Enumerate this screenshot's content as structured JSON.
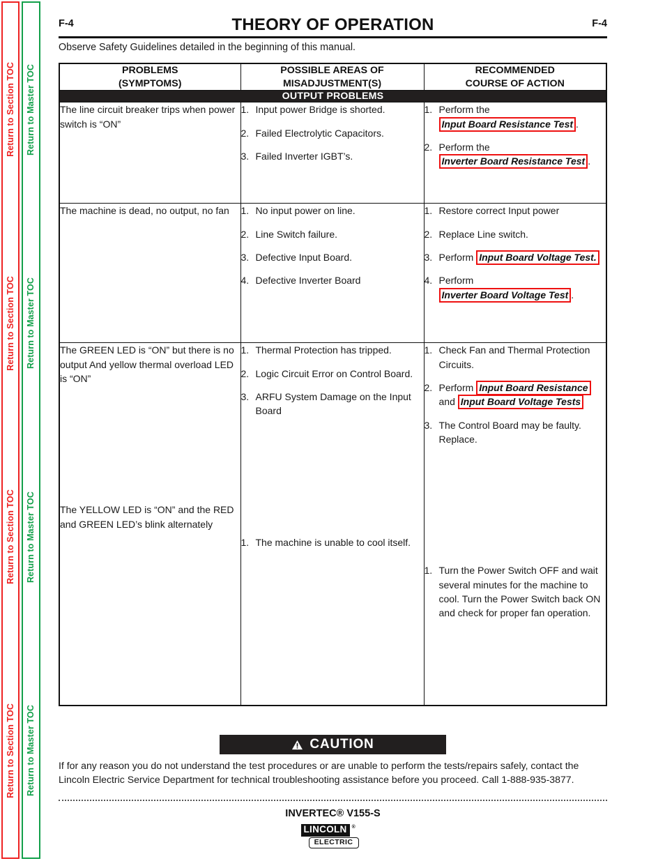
{
  "sidebar": {
    "section_toc_label": "Return to Section TOC",
    "master_toc_label": "Return to Master TOC",
    "repeat_count": 4,
    "section_toc_color": "#ee2222",
    "master_toc_color": "#12a04a"
  },
  "header": {
    "folio_left": "F-4",
    "folio_right": "F-4",
    "title": "THEORY OF OPERATION"
  },
  "safety_note": "Observe Safety Guidelines detailed in the beginning of this manual.",
  "table": {
    "headers": {
      "col1_line1": "PROBLEMS",
      "col1_line2": "(SYMPTOMS)",
      "col2_line1": "POSSIBLE AREAS OF",
      "col2_line2": "MISADJUSTMENT(S)",
      "col3_line1": "RECOMMENDED",
      "col3_line2": "COURSE OF ACTION"
    },
    "band_label": "OUTPUT PROBLEMS",
    "rows": [
      {
        "symptom": "The line circuit breaker trips when power switch is “ON”",
        "areas": [
          {
            "num": "1.",
            "text": "Input power Bridge is shorted."
          },
          {
            "num": "2.",
            "text": "Failed Electrolytic Capacitors."
          },
          {
            "num": "3.",
            "text": "Failed Inverter IGBT’s."
          }
        ],
        "actions": [
          {
            "num": "1.",
            "pre": "Perform the ",
            "link": "Input Board Resistance Test",
            "post": "."
          },
          {
            "num": "2.",
            "pre": "Perform the ",
            "link": "Inverter Board Resistance Test",
            "post": "."
          }
        ]
      },
      {
        "symptom": "The machine is dead, no output, no fan",
        "areas": [
          {
            "num": "1.",
            "text": "No input power on line."
          },
          {
            "num": "2.",
            "text": "Line Switch failure."
          },
          {
            "num": "3.",
            "text": "Defective Input Board."
          },
          {
            "num": "4.",
            "text": "Defective Inverter Board"
          }
        ],
        "actions": [
          {
            "num": "1.",
            "pre": "Restore correct Input power",
            "link": "",
            "post": ""
          },
          {
            "num": "2.",
            "pre": "Replace Line switch.",
            "link": "",
            "post": ""
          },
          {
            "num": "3.",
            "pre": "Perform ",
            "link": "Input Board Voltage Test.",
            "post": ""
          },
          {
            "num": "4.",
            "pre": "Perform ",
            "link": "Inverter Board Voltage Test",
            "post": "."
          }
        ]
      },
      {
        "symptom": "The GREEN  LED is “ON” but there is no output And yellow thermal overload LED is “ON”",
        "symptom2": "The YELLOW LED is “ON” and the RED and GREEN LED’s blink alternately",
        "areas": [
          {
            "num": "1.",
            "text": "Thermal Protection has tripped."
          },
          {
            "num": "2.",
            "text": "Logic Circuit Error on Control Board."
          },
          {
            "num": "3.",
            "text": "ARFU System Damage on the Input Board"
          }
        ],
        "areas2": [
          {
            "num": "1.",
            "text": "The machine is unable to cool itself."
          }
        ],
        "actions": [
          {
            "num": "1.",
            "pre": "Check Fan and Thermal Protection Circuits.",
            "link": "",
            "post": ""
          },
          {
            "num": "2.",
            "pre": "Perform ",
            "link": "Input Board Resistance",
            "mid": " and ",
            "link2": "Input Board Voltage Tests",
            "post": ""
          },
          {
            "num": "3.",
            "pre": "The Control Board may be faulty. Replace.",
            "link": "",
            "post": ""
          }
        ],
        "actions2": [
          {
            "num": "1.",
            "pre": "Turn the Power Switch OFF and wait several minutes for the machine to cool.  Turn the Power Switch back ON and check for proper fan operation.",
            "link": "",
            "post": ""
          }
        ]
      }
    ]
  },
  "caution": {
    "label": "CAUTION",
    "icon": "warning-triangle-icon",
    "body": "If for any reason you do not understand the test procedures or are unable to perform the tests/repairs safely, contact the Lincoln Electric Service Department for technical troubleshooting assistance before you proceed. Call 1-888-935-3877."
  },
  "footer": {
    "product": "INVERTEC® V155-S",
    "logo_word": "LINCOLN",
    "logo_reg": "®",
    "logo_sub": "ELECTRIC"
  }
}
